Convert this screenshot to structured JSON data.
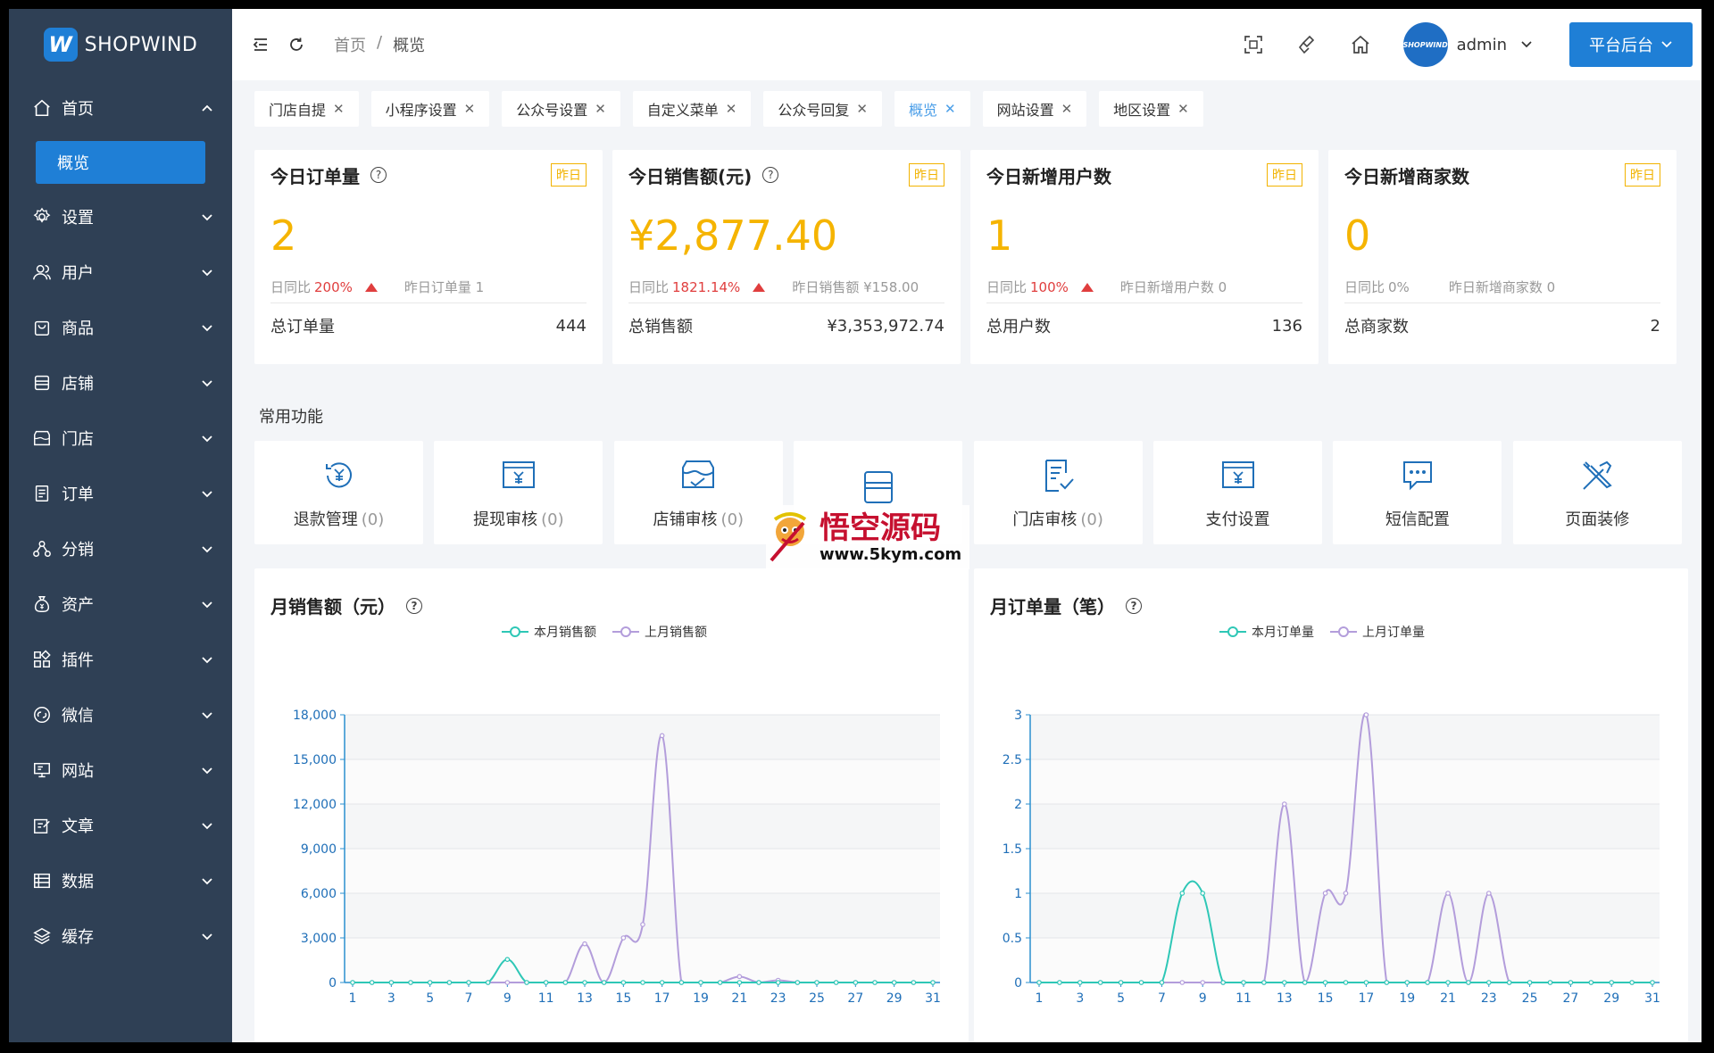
{
  "brand": {
    "name": "SHOPWIND",
    "mark": "W"
  },
  "sidebar": {
    "items": [
      {
        "label": "首页",
        "icon": "home-icon",
        "expanded": true
      },
      {
        "label": "设置",
        "icon": "gear-icon"
      },
      {
        "label": "用户",
        "icon": "users-icon"
      },
      {
        "label": "商品",
        "icon": "bag-icon"
      },
      {
        "label": "店铺",
        "icon": "store-icon"
      },
      {
        "label": "门店",
        "icon": "shop-icon"
      },
      {
        "label": "订单",
        "icon": "order-icon"
      },
      {
        "label": "分销",
        "icon": "network-icon"
      },
      {
        "label": "资产",
        "icon": "money-bag-icon"
      },
      {
        "label": "插件",
        "icon": "plugin-icon"
      },
      {
        "label": "微信",
        "icon": "wechat-icon"
      },
      {
        "label": "网站",
        "icon": "monitor-icon"
      },
      {
        "label": "文章",
        "icon": "edit-icon"
      },
      {
        "label": "数据",
        "icon": "table-icon"
      },
      {
        "label": "缓存",
        "icon": "layers-icon"
      }
    ],
    "sub_active": "概览"
  },
  "header": {
    "breadcrumb": [
      "首页",
      "/",
      "概览"
    ],
    "user": "admin",
    "avatar_text": "SHOPWIND",
    "platform_button": "平台后台"
  },
  "tabs": [
    {
      "label": "门店自提",
      "active": false
    },
    {
      "label": "小程序设置",
      "active": false
    },
    {
      "label": "公众号设置",
      "active": false
    },
    {
      "label": "自定义菜单",
      "active": false
    },
    {
      "label": "公众号回复",
      "active": false
    },
    {
      "label": "概览",
      "active": true
    },
    {
      "label": "网站设置",
      "active": false
    },
    {
      "label": "地区设置",
      "active": false
    }
  ],
  "stats": [
    {
      "title": "今日订单量",
      "help": true,
      "badge": "昨日",
      "value": "2",
      "cmp_label": "日同比",
      "cmp_pct": "200%",
      "up": true,
      "yesterday": "昨日订单量 1",
      "foot_label": "总订单量",
      "foot_value": "444"
    },
    {
      "title": "今日销售额(元)",
      "help": true,
      "badge": "昨日",
      "value": "¥2,877.40",
      "cmp_label": "日同比",
      "cmp_pct": "1821.14%",
      "up": true,
      "yesterday": "昨日销售额 ¥158.00",
      "foot_label": "总销售额",
      "foot_value": "¥3,353,972.74"
    },
    {
      "title": "今日新增用户数",
      "help": false,
      "badge": "昨日",
      "value": "1",
      "cmp_label": "日同比",
      "cmp_pct": "100%",
      "up": true,
      "yesterday": "昨日新增用户数 0",
      "foot_label": "总用户数",
      "foot_value": "136"
    },
    {
      "title": "今日新增商家数",
      "help": false,
      "badge": "昨日",
      "value": "0",
      "cmp_label": "日同比",
      "cmp_pct": "0%",
      "up": false,
      "yesterday": "昨日新增商家数 0",
      "foot_label": "总商家数",
      "foot_value": "2"
    }
  ],
  "common": {
    "title": "常用功能",
    "items": [
      {
        "label": "退款管理",
        "count": "(0)",
        "icon": "refund-icon"
      },
      {
        "label": "提现审核",
        "count": "(0)",
        "icon": "withdraw-icon"
      },
      {
        "label": "店铺审核",
        "count": "(0)",
        "icon": "store-review-icon"
      },
      {
        "label": "",
        "count": "",
        "icon": "box-icon"
      },
      {
        "label": "门店审核",
        "count": "(0)",
        "icon": "doc-check-icon"
      },
      {
        "label": "支付设置",
        "count": "",
        "icon": "payment-icon"
      },
      {
        "label": "短信配置",
        "count": "",
        "icon": "message-icon"
      },
      {
        "label": "页面装修",
        "count": "",
        "icon": "tools-icon"
      }
    ]
  },
  "watermark": {
    "cn": "悟空源码",
    "url": "www.5kym.com"
  },
  "colors": {
    "accent": "#1f7fd6",
    "sidebar": "#2f4055",
    "stat_value": "#f5b400",
    "up": "#e03e3e",
    "series_current": "#2ec7b6",
    "series_last": "#b39ddb",
    "axis": "#2a8fcf"
  },
  "chart_data": [
    {
      "type": "line",
      "title": "月销售额（元）",
      "x": [
        1,
        2,
        3,
        4,
        5,
        6,
        7,
        8,
        9,
        10,
        11,
        12,
        13,
        14,
        15,
        16,
        17,
        18,
        19,
        20,
        21,
        22,
        23,
        24,
        25,
        26,
        27,
        28,
        29,
        30,
        31
      ],
      "x_ticks": [
        1,
        3,
        5,
        7,
        9,
        11,
        13,
        15,
        17,
        19,
        21,
        23,
        25,
        27,
        29,
        31
      ],
      "ylim": [
        0,
        18000
      ],
      "y_ticks": [
        "0",
        "3,000",
        "6,000",
        "9,000",
        "12,000",
        "15,000",
        "18,000"
      ],
      "series": [
        {
          "name": "本月销售额",
          "values": [
            0,
            0,
            0,
            0,
            0,
            0,
            0,
            0,
            1550,
            0,
            0,
            0,
            0,
            0,
            0,
            0,
            0,
            0,
            0,
            0,
            0,
            0,
            0,
            0,
            0,
            0,
            0,
            0,
            0,
            0,
            0
          ]
        },
        {
          "name": "上月销售额",
          "values": [
            0,
            0,
            0,
            0,
            0,
            0,
            0,
            0,
            0,
            0,
            0,
            0,
            2600,
            0,
            3000,
            3900,
            16600,
            0,
            0,
            0,
            400,
            0,
            150,
            0,
            0,
            0,
            0,
            0,
            0,
            0,
            0
          ]
        }
      ],
      "grid": true,
      "legend": "top-center"
    },
    {
      "type": "line",
      "title": "月订单量（笔）",
      "x": [
        1,
        2,
        3,
        4,
        5,
        6,
        7,
        8,
        9,
        10,
        11,
        12,
        13,
        14,
        15,
        16,
        17,
        18,
        19,
        20,
        21,
        22,
        23,
        24,
        25,
        26,
        27,
        28,
        29,
        30,
        31
      ],
      "x_ticks": [
        1,
        3,
        5,
        7,
        9,
        11,
        13,
        15,
        17,
        19,
        21,
        23,
        25,
        27,
        29,
        31
      ],
      "ylim": [
        0,
        3
      ],
      "y_ticks": [
        "0",
        "0.5",
        "1",
        "1.5",
        "2",
        "2.5",
        "3"
      ],
      "series": [
        {
          "name": "本月订单量",
          "values": [
            0,
            0,
            0,
            0,
            0,
            0,
            0,
            1,
            1,
            0,
            0,
            0,
            0,
            0,
            0,
            0,
            0,
            0,
            0,
            0,
            0,
            0,
            0,
            0,
            0,
            0,
            0,
            0,
            0,
            0,
            0
          ]
        },
        {
          "name": "上月订单量",
          "values": [
            0,
            0,
            0,
            0,
            0,
            0,
            0,
            0,
            0,
            0,
            0,
            0,
            2,
            0,
            1,
            1,
            3,
            0,
            0,
            0,
            1,
            0,
            1,
            0,
            0,
            0,
            0,
            0,
            0,
            0,
            0
          ]
        }
      ],
      "grid": true,
      "legend": "top-center"
    }
  ]
}
